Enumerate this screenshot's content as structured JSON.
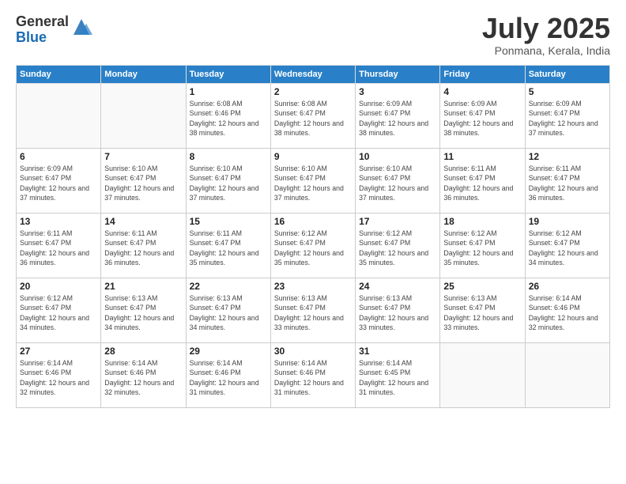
{
  "logo": {
    "general": "General",
    "blue": "Blue"
  },
  "header": {
    "month": "July 2025",
    "location": "Ponmana, Kerala, India"
  },
  "days_of_week": [
    "Sunday",
    "Monday",
    "Tuesday",
    "Wednesday",
    "Thursday",
    "Friday",
    "Saturday"
  ],
  "weeks": [
    [
      {
        "day": "",
        "sunrise": "",
        "sunset": "",
        "daylight": ""
      },
      {
        "day": "",
        "sunrise": "",
        "sunset": "",
        "daylight": ""
      },
      {
        "day": "1",
        "sunrise": "Sunrise: 6:08 AM",
        "sunset": "Sunset: 6:46 PM",
        "daylight": "Daylight: 12 hours and 38 minutes."
      },
      {
        "day": "2",
        "sunrise": "Sunrise: 6:08 AM",
        "sunset": "Sunset: 6:47 PM",
        "daylight": "Daylight: 12 hours and 38 minutes."
      },
      {
        "day": "3",
        "sunrise": "Sunrise: 6:09 AM",
        "sunset": "Sunset: 6:47 PM",
        "daylight": "Daylight: 12 hours and 38 minutes."
      },
      {
        "day": "4",
        "sunrise": "Sunrise: 6:09 AM",
        "sunset": "Sunset: 6:47 PM",
        "daylight": "Daylight: 12 hours and 38 minutes."
      },
      {
        "day": "5",
        "sunrise": "Sunrise: 6:09 AM",
        "sunset": "Sunset: 6:47 PM",
        "daylight": "Daylight: 12 hours and 37 minutes."
      }
    ],
    [
      {
        "day": "6",
        "sunrise": "Sunrise: 6:09 AM",
        "sunset": "Sunset: 6:47 PM",
        "daylight": "Daylight: 12 hours and 37 minutes."
      },
      {
        "day": "7",
        "sunrise": "Sunrise: 6:10 AM",
        "sunset": "Sunset: 6:47 PM",
        "daylight": "Daylight: 12 hours and 37 minutes."
      },
      {
        "day": "8",
        "sunrise": "Sunrise: 6:10 AM",
        "sunset": "Sunset: 6:47 PM",
        "daylight": "Daylight: 12 hours and 37 minutes."
      },
      {
        "day": "9",
        "sunrise": "Sunrise: 6:10 AM",
        "sunset": "Sunset: 6:47 PM",
        "daylight": "Daylight: 12 hours and 37 minutes."
      },
      {
        "day": "10",
        "sunrise": "Sunrise: 6:10 AM",
        "sunset": "Sunset: 6:47 PM",
        "daylight": "Daylight: 12 hours and 37 minutes."
      },
      {
        "day": "11",
        "sunrise": "Sunrise: 6:11 AM",
        "sunset": "Sunset: 6:47 PM",
        "daylight": "Daylight: 12 hours and 36 minutes."
      },
      {
        "day": "12",
        "sunrise": "Sunrise: 6:11 AM",
        "sunset": "Sunset: 6:47 PM",
        "daylight": "Daylight: 12 hours and 36 minutes."
      }
    ],
    [
      {
        "day": "13",
        "sunrise": "Sunrise: 6:11 AM",
        "sunset": "Sunset: 6:47 PM",
        "daylight": "Daylight: 12 hours and 36 minutes."
      },
      {
        "day": "14",
        "sunrise": "Sunrise: 6:11 AM",
        "sunset": "Sunset: 6:47 PM",
        "daylight": "Daylight: 12 hours and 36 minutes."
      },
      {
        "day": "15",
        "sunrise": "Sunrise: 6:11 AM",
        "sunset": "Sunset: 6:47 PM",
        "daylight": "Daylight: 12 hours and 35 minutes."
      },
      {
        "day": "16",
        "sunrise": "Sunrise: 6:12 AM",
        "sunset": "Sunset: 6:47 PM",
        "daylight": "Daylight: 12 hours and 35 minutes."
      },
      {
        "day": "17",
        "sunrise": "Sunrise: 6:12 AM",
        "sunset": "Sunset: 6:47 PM",
        "daylight": "Daylight: 12 hours and 35 minutes."
      },
      {
        "day": "18",
        "sunrise": "Sunrise: 6:12 AM",
        "sunset": "Sunset: 6:47 PM",
        "daylight": "Daylight: 12 hours and 35 minutes."
      },
      {
        "day": "19",
        "sunrise": "Sunrise: 6:12 AM",
        "sunset": "Sunset: 6:47 PM",
        "daylight": "Daylight: 12 hours and 34 minutes."
      }
    ],
    [
      {
        "day": "20",
        "sunrise": "Sunrise: 6:12 AM",
        "sunset": "Sunset: 6:47 PM",
        "daylight": "Daylight: 12 hours and 34 minutes."
      },
      {
        "day": "21",
        "sunrise": "Sunrise: 6:13 AM",
        "sunset": "Sunset: 6:47 PM",
        "daylight": "Daylight: 12 hours and 34 minutes."
      },
      {
        "day": "22",
        "sunrise": "Sunrise: 6:13 AM",
        "sunset": "Sunset: 6:47 PM",
        "daylight": "Daylight: 12 hours and 34 minutes."
      },
      {
        "day": "23",
        "sunrise": "Sunrise: 6:13 AM",
        "sunset": "Sunset: 6:47 PM",
        "daylight": "Daylight: 12 hours and 33 minutes."
      },
      {
        "day": "24",
        "sunrise": "Sunrise: 6:13 AM",
        "sunset": "Sunset: 6:47 PM",
        "daylight": "Daylight: 12 hours and 33 minutes."
      },
      {
        "day": "25",
        "sunrise": "Sunrise: 6:13 AM",
        "sunset": "Sunset: 6:47 PM",
        "daylight": "Daylight: 12 hours and 33 minutes."
      },
      {
        "day": "26",
        "sunrise": "Sunrise: 6:14 AM",
        "sunset": "Sunset: 6:46 PM",
        "daylight": "Daylight: 12 hours and 32 minutes."
      }
    ],
    [
      {
        "day": "27",
        "sunrise": "Sunrise: 6:14 AM",
        "sunset": "Sunset: 6:46 PM",
        "daylight": "Daylight: 12 hours and 32 minutes."
      },
      {
        "day": "28",
        "sunrise": "Sunrise: 6:14 AM",
        "sunset": "Sunset: 6:46 PM",
        "daylight": "Daylight: 12 hours and 32 minutes."
      },
      {
        "day": "29",
        "sunrise": "Sunrise: 6:14 AM",
        "sunset": "Sunset: 6:46 PM",
        "daylight": "Daylight: 12 hours and 31 minutes."
      },
      {
        "day": "30",
        "sunrise": "Sunrise: 6:14 AM",
        "sunset": "Sunset: 6:46 PM",
        "daylight": "Daylight: 12 hours and 31 minutes."
      },
      {
        "day": "31",
        "sunrise": "Sunrise: 6:14 AM",
        "sunset": "Sunset: 6:45 PM",
        "daylight": "Daylight: 12 hours and 31 minutes."
      },
      {
        "day": "",
        "sunrise": "",
        "sunset": "",
        "daylight": ""
      },
      {
        "day": "",
        "sunrise": "",
        "sunset": "",
        "daylight": ""
      }
    ]
  ]
}
